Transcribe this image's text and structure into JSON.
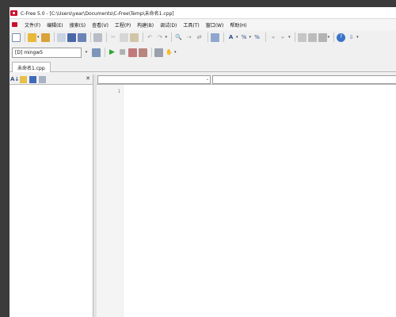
{
  "window": {
    "title": "C-Free 5.0 - [C:\\Users\\year\\Documents\\C-Free\\Temp\\未命名1.cpp]"
  },
  "menu": [
    "文件(F)",
    "编辑(E)",
    "搜索(S)",
    "查看(V)",
    "工程(P)",
    "构建(B)",
    "调试(D)",
    "工具(T)",
    "窗口(W)",
    "帮助(H)"
  ],
  "toolbar": {
    "compiler": "[D] mingw5"
  },
  "tabs": {
    "active_file": "未命名1.cpp"
  },
  "editor": {
    "line_numbers": [
      "1"
    ]
  },
  "colors": {
    "app_accent": "#c8102e",
    "run_green": "#2aa52a"
  }
}
